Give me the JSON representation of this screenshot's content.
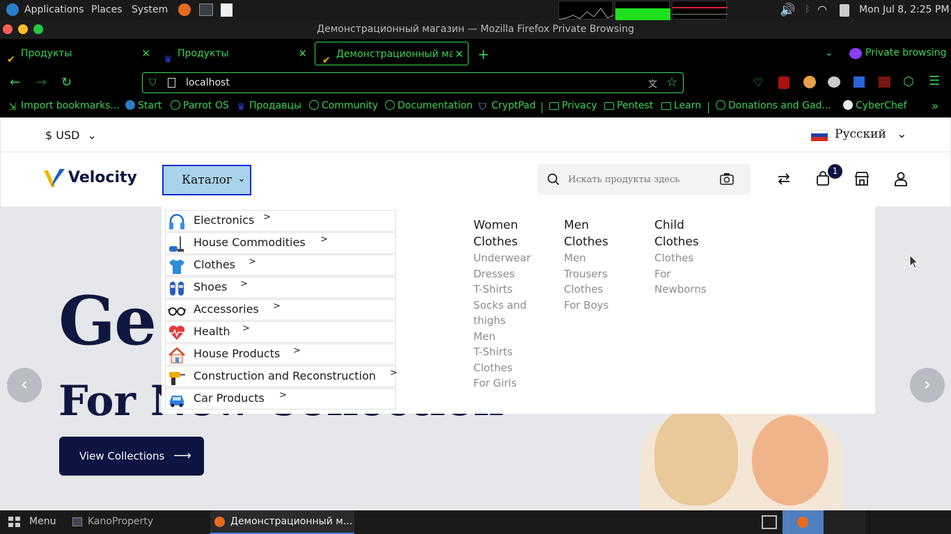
{
  "os_panel": {
    "menus": [
      "Applications",
      "Places",
      "System"
    ],
    "clock": "Mon Jul  8,  2:25 PM"
  },
  "window": {
    "title": "Демонстрационный магазин — Mozilla Firefox Private Browsing"
  },
  "tabs": [
    {
      "label": "Продукты"
    },
    {
      "label": "Продукты"
    },
    {
      "label": "Демонстрационный маг"
    }
  ],
  "private_label": "Private browsing",
  "url": "localhost",
  "bookmarks": [
    "Import bookmarks...",
    "Start",
    "Parrot OS",
    "Продавцы",
    "Community",
    "Documentation",
    "CryptPad",
    "Privacy",
    "Pentest",
    "Learn",
    "Donations and Gad...",
    "CyberChef"
  ],
  "store": {
    "currency": "$ USD",
    "language": "Русский",
    "logo": "Velocity",
    "catalog_label": "Каталог",
    "search_placeholder": "Искать продукты здесь",
    "cart_count": "1"
  },
  "categories": [
    {
      "label": "Electronics",
      "icon": "headphones-icon"
    },
    {
      "label": "House Commodities",
      "icon": "vacuum-icon"
    },
    {
      "label": "Clothes",
      "icon": "tshirt-icon"
    },
    {
      "label": "Shoes",
      "icon": "shoes-icon"
    },
    {
      "label": "Accessories",
      "icon": "glasses-icon"
    },
    {
      "label": "Health",
      "icon": "heart-icon"
    },
    {
      "label": "House Products",
      "icon": "house-icon"
    },
    {
      "label": "Construction and Reconstruction",
      "icon": "drill-icon"
    },
    {
      "label": "Car Products",
      "icon": "car-icon"
    }
  ],
  "submenu": [
    {
      "heading": [
        "Women",
        "Clothes"
      ],
      "items": [
        "Underwear",
        "Dresses",
        "T-Shirts",
        "Socks and",
        "thighs",
        "Men",
        "T-Shirts",
        "Clothes",
        "For Girls"
      ]
    },
    {
      "heading": [
        "Men",
        "Clothes"
      ],
      "items": [
        "Men",
        "Trousers",
        "Clothes",
        "For Boys"
      ]
    },
    {
      "heading": [
        "Child",
        "Clothes"
      ],
      "items": [
        "Clothes",
        "For",
        "Newborns"
      ]
    }
  ],
  "hero": {
    "title_visible": "Ge",
    "subtitle_visible": "For New Collection",
    "button": "View Collections"
  },
  "taskbar": {
    "menu": "Menu",
    "items": [
      "KanoProperty",
      "Демонстрационный м..."
    ]
  },
  "colors": {
    "accent_green": "#39d353",
    "navy": "#0f1740",
    "catalog_bg": "#a8d3ea"
  }
}
